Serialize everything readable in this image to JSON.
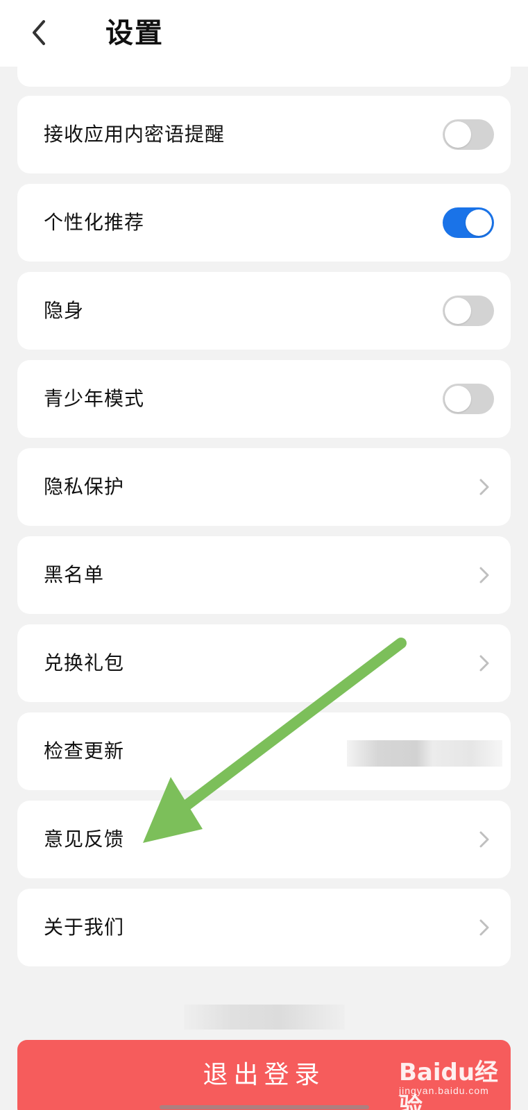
{
  "header": {
    "title": "设置",
    "back_icon": "chevron-left-icon"
  },
  "settings": [
    {
      "label": "接收应用内密语提醒",
      "control": "toggle",
      "on": false
    },
    {
      "label": "个性化推荐",
      "control": "toggle",
      "on": true
    },
    {
      "label": "隐身",
      "control": "toggle",
      "on": false
    },
    {
      "label": "青少年模式",
      "control": "toggle",
      "on": false
    },
    {
      "label": "隐私保护",
      "control": "chevron"
    },
    {
      "label": "黑名单",
      "control": "chevron"
    },
    {
      "label": "兑换礼包",
      "control": "chevron"
    },
    {
      "label": "检查更新",
      "control": "redacted"
    },
    {
      "label": "意见反馈",
      "control": "chevron"
    },
    {
      "label": "关于我们",
      "control": "chevron"
    }
  ],
  "logout": {
    "label": "退出登录"
  },
  "colors": {
    "background": "#f2f2f2",
    "card": "#ffffff",
    "toggle_on": "#1a73e8",
    "toggle_off": "#d3d3d3",
    "logout": "#f65c5c",
    "annotation_arrow": "#7cbf5a",
    "chevron": "#bfbfbf"
  },
  "watermark": {
    "brand": "Baidu经验",
    "sub": "jingyan.baidu.com"
  }
}
